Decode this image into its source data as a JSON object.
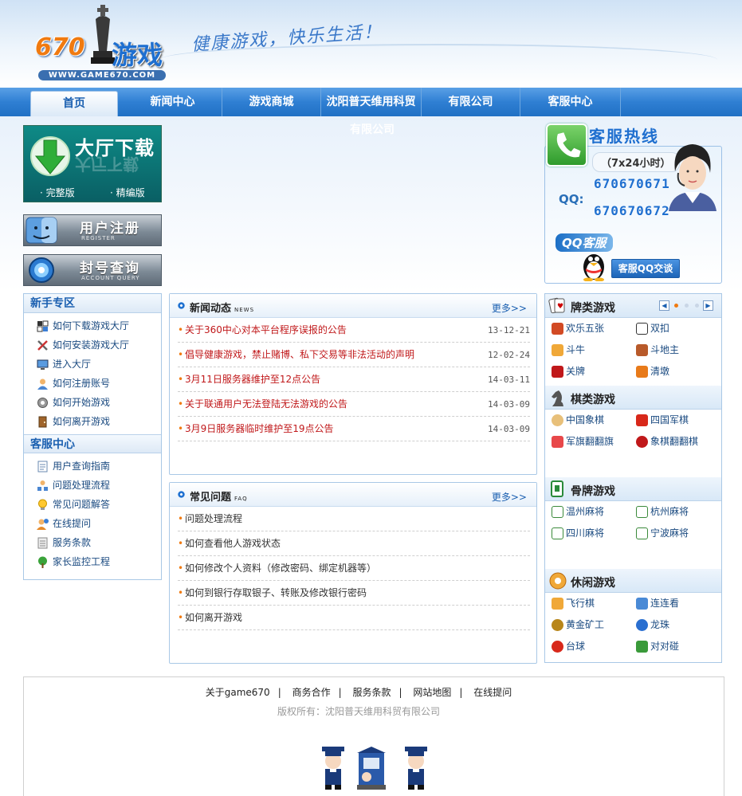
{
  "header": {
    "logo_number": "670",
    "logo_text": "游戏",
    "logo_url": "WWW.GAME670.COM",
    "slogan": "健康游戏，快乐生活！"
  },
  "nav": {
    "items": [
      {
        "label": "首页",
        "active": true
      },
      {
        "label": "新闻中心"
      },
      {
        "label": "游戏商城"
      },
      {
        "label": "沈阳普天维用科贸"
      },
      {
        "label": "有限公司"
      },
      {
        "label": "客服中心"
      }
    ],
    "overflow_text": "有限公司"
  },
  "download": {
    "title": "大厅下载",
    "full_label": "· 完整版",
    "lite_label": "· 精编版"
  },
  "register": {
    "title": "用户注册",
    "subtitle": "REGISTER"
  },
  "account_query": {
    "title": "封号查询",
    "subtitle": "ACCOUNT QUERY"
  },
  "service": {
    "title": "客服热线",
    "hours": "（7x24小时）",
    "qq_label": "QQ:",
    "qq_numbers": [
      "670670671",
      "670670672"
    ],
    "qq_service_label": "QQ客服",
    "qq_chat_button": "客服QQ交谈"
  },
  "newbie": {
    "title": "新手专区",
    "items": [
      {
        "label": "如何下载游戏大厅",
        "icon": "window-icon"
      },
      {
        "label": "如何安装游戏大厅",
        "icon": "tools-icon"
      },
      {
        "label": "进入大厅",
        "icon": "monitor-icon"
      },
      {
        "label": "如何注册账号",
        "icon": "user-icon"
      },
      {
        "label": "如何开始游戏",
        "icon": "gear-icon"
      },
      {
        "label": "如何离开游戏",
        "icon": "door-icon"
      }
    ]
  },
  "support": {
    "title": "客服中心",
    "items": [
      {
        "label": "用户查询指南",
        "icon": "document-icon"
      },
      {
        "label": "问题处理流程",
        "icon": "flow-icon"
      },
      {
        "label": "常见问题解答",
        "icon": "bulb-icon"
      },
      {
        "label": "在线提问",
        "icon": "question-user-icon"
      },
      {
        "label": "服务条款",
        "icon": "list-icon"
      },
      {
        "label": "家长监控工程",
        "icon": "tree-icon"
      }
    ]
  },
  "news": {
    "title": "新闻动态",
    "title_en": "NEWS",
    "more": "更多>>",
    "items": [
      {
        "title": "关于360中心对本平台程序误报的公告",
        "date": "13-12-21"
      },
      {
        "title": "倡导健康游戏，禁止赌博、私下交易等非法活动的声明",
        "date": "12-02-24"
      },
      {
        "title": "3月11日服务器维护至12点公告",
        "date": "14-03-11"
      },
      {
        "title": "关于联通用户无法登陆无法游戏的公告",
        "date": "14-03-09"
      },
      {
        "title": "3月9日服务器临时维护至19点公告",
        "date": "14-03-09"
      }
    ]
  },
  "faq": {
    "title": "常见问题",
    "title_en": "FAQ",
    "more": "更多>>",
    "items": [
      "问题处理流程",
      "如何查看他人游戏状态",
      "如何修改个人资料（修改密码、绑定机器等）",
      "如何到银行存取银子、转账及修改银行密码",
      "如何离开游戏"
    ]
  },
  "games": {
    "card": {
      "title": "牌类游戏",
      "items": [
        {
          "label": "欢乐五张",
          "icon": "dice-icon"
        },
        {
          "label": "双扣",
          "icon": "spade-card-icon"
        },
        {
          "label": "斗牛",
          "icon": "bull-icon"
        },
        {
          "label": "斗地主",
          "icon": "farmer-icon"
        },
        {
          "label": "关牌",
          "icon": "card-icon"
        },
        {
          "label": "清墩",
          "icon": "chips-icon"
        }
      ]
    },
    "chess": {
      "title": "棋类游戏",
      "items": [
        {
          "label": "中国象棋",
          "icon": "xiangqi-icon"
        },
        {
          "label": "四国军棋",
          "icon": "flag-icon"
        },
        {
          "label": "军旗翻翻旗",
          "icon": "red-flag-icon"
        },
        {
          "label": "象棋翻翻棋",
          "icon": "red-piece-icon"
        }
      ]
    },
    "mahjong": {
      "title": "骨牌游戏",
      "items": [
        {
          "label": "温州麻将",
          "icon": "mahjong-icon"
        },
        {
          "label": "杭州麻将",
          "icon": "mahjong-icon"
        },
        {
          "label": "四川麻将",
          "icon": "mahjong-icon"
        },
        {
          "label": "宁波麻将",
          "icon": "mahjong-icon"
        }
      ]
    },
    "casual": {
      "title": "休闲游戏",
      "items": [
        {
          "label": "飞行棋",
          "icon": "plane-icon"
        },
        {
          "label": "连连看",
          "icon": "link-icon"
        },
        {
          "label": "黄金矿工",
          "icon": "miner-icon"
        },
        {
          "label": "龙珠",
          "icon": "globe-icon"
        },
        {
          "label": "台球",
          "icon": "ball-icon"
        },
        {
          "label": "对对碰",
          "icon": "match-icon"
        }
      ]
    }
  },
  "footer": {
    "links": [
      "关于game670",
      "商务合作",
      "服务条款",
      "网站地图",
      "在线提问"
    ],
    "copyright": "版权所有：沈阳普天维用科贸有限公司"
  },
  "colors": {
    "nav_blue": "#2f7fd3",
    "news_red": "#c0181a",
    "bullet_orange": "#f07a10",
    "link_blue": "#1a4a80"
  }
}
